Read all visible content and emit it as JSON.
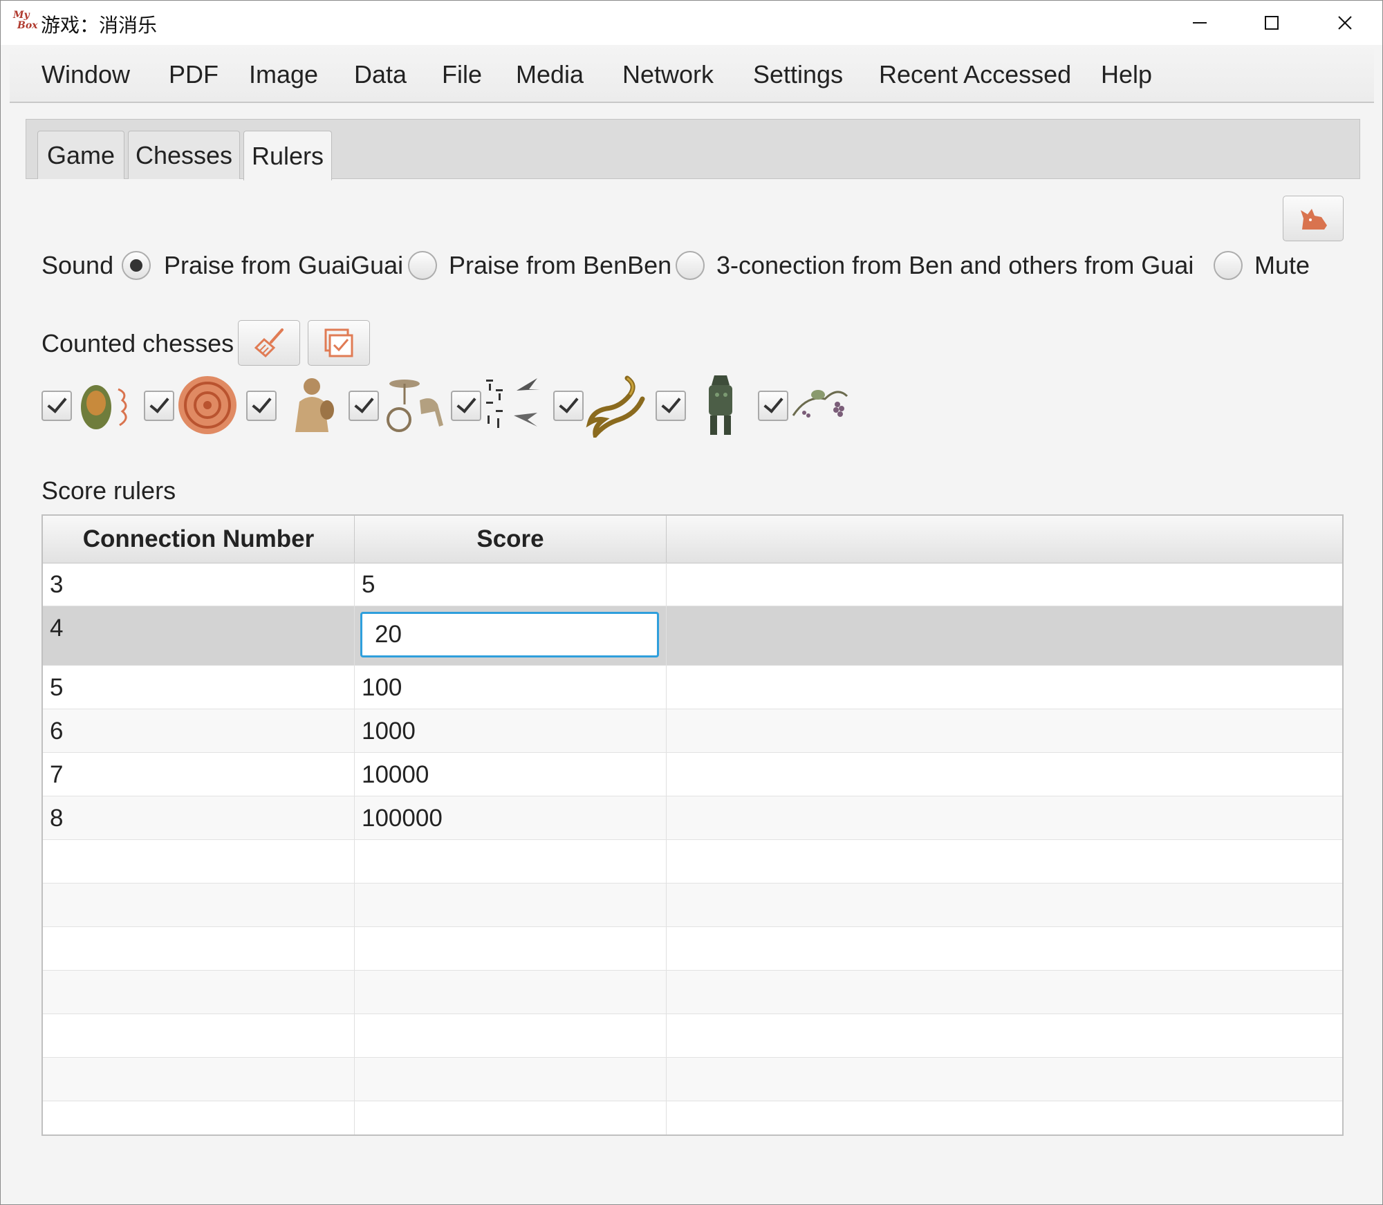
{
  "window": {
    "title": "游戏：消消乐",
    "logo_text_top": "My",
    "logo_text_bottom": "Box"
  },
  "menubar": {
    "items": [
      "Window",
      "PDF",
      "Image",
      "Data",
      "File",
      "Media",
      "Network",
      "Settings",
      "Recent Accessed",
      "Help"
    ]
  },
  "tabs": {
    "items": [
      "Game",
      "Chesses",
      "Rulers"
    ],
    "active": "Rulers"
  },
  "sound": {
    "label": "Sound",
    "options": [
      "Praise from GuaiGuai",
      "Praise from BenBen",
      "3-conection from Ben and others from Guai",
      "Mute"
    ],
    "selected": "Praise from GuaiGuai"
  },
  "counted_chesses": {
    "label": "Counted chesses",
    "items": [
      {
        "name": "jade-vessel",
        "checked": true
      },
      {
        "name": "round-seal",
        "checked": true
      },
      {
        "name": "figurine",
        "checked": true
      },
      {
        "name": "chariot",
        "checked": true
      },
      {
        "name": "calligraphy-cranes",
        "checked": true
      },
      {
        "name": "golden-dragon",
        "checked": true
      },
      {
        "name": "bronze-statue",
        "checked": true
      },
      {
        "name": "grape-painting",
        "checked": true
      }
    ]
  },
  "score_rulers": {
    "label": "Score rulers",
    "columns": [
      "Connection Number",
      "Score"
    ],
    "rows": [
      {
        "connection": "3",
        "score": "5"
      },
      {
        "connection": "4",
        "score": "20"
      },
      {
        "connection": "5",
        "score": "100"
      },
      {
        "connection": "6",
        "score": "1000"
      },
      {
        "connection": "7",
        "score": "10000"
      },
      {
        "connection": "8",
        "score": "100000"
      }
    ],
    "editing_row": 1
  },
  "colors": {
    "accent_orange": "#e07b54",
    "focus_blue": "#2f9fdc",
    "selected_row": "#d3d3d3"
  }
}
